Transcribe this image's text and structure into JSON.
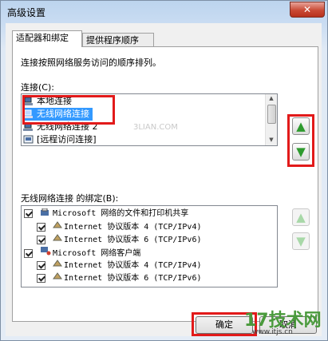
{
  "window": {
    "title": "高级设置",
    "close_glyph": "✕"
  },
  "tabs": [
    {
      "label": "适配器和绑定",
      "active": true
    },
    {
      "label": "提供程序顺序",
      "active": false
    }
  ],
  "panel": {
    "description": "连接按照网络服务访问的顺序排列。",
    "connections_label": "连接(C):",
    "connections": [
      {
        "label": "本地连接",
        "icon": "network-adapter-icon"
      },
      {
        "label": "无线网络连接",
        "icon": "network-adapter-icon",
        "selected": true
      },
      {
        "label": "无线网络连接 2",
        "icon": "network-adapter-icon"
      },
      {
        "label": "[远程访问连接]",
        "icon": "remote-access-icon"
      }
    ],
    "move_up": "▲",
    "move_down": "▼",
    "bindings_label": "无线网络连接 的绑定(B):",
    "bindings": [
      {
        "label": "Microsoft 网络的文件和打印机共享",
        "level": 0,
        "checked": true,
        "icon": "file-printer-sharing-icon"
      },
      {
        "label": "Internet 协议版本 4 (TCP/IPv4)",
        "level": 1,
        "checked": true,
        "icon": "protocol-icon"
      },
      {
        "label": "Internet 协议版本 6 (TCP/IPv6)",
        "level": 1,
        "checked": true,
        "icon": "protocol-icon"
      },
      {
        "label": "Microsoft 网络客户端",
        "level": 0,
        "checked": true,
        "icon": "network-client-icon"
      },
      {
        "label": "Internet 协议版本 4 (TCP/IPv4)",
        "level": 1,
        "checked": true,
        "icon": "protocol-icon"
      },
      {
        "label": "Internet 协议版本 6 (TCP/IPv6)",
        "level": 1,
        "checked": true,
        "icon": "protocol-icon"
      }
    ]
  },
  "buttons": {
    "ok": "确定",
    "cancel": "取消"
  },
  "watermark": {
    "center": "3LIAN.COM",
    "logo": "17技术网",
    "url": "www.itjs.cn"
  },
  "colors": {
    "highlight_box": "#e21a1a",
    "selection": "#3399ff",
    "arrow_green": "#2e9a2e"
  }
}
